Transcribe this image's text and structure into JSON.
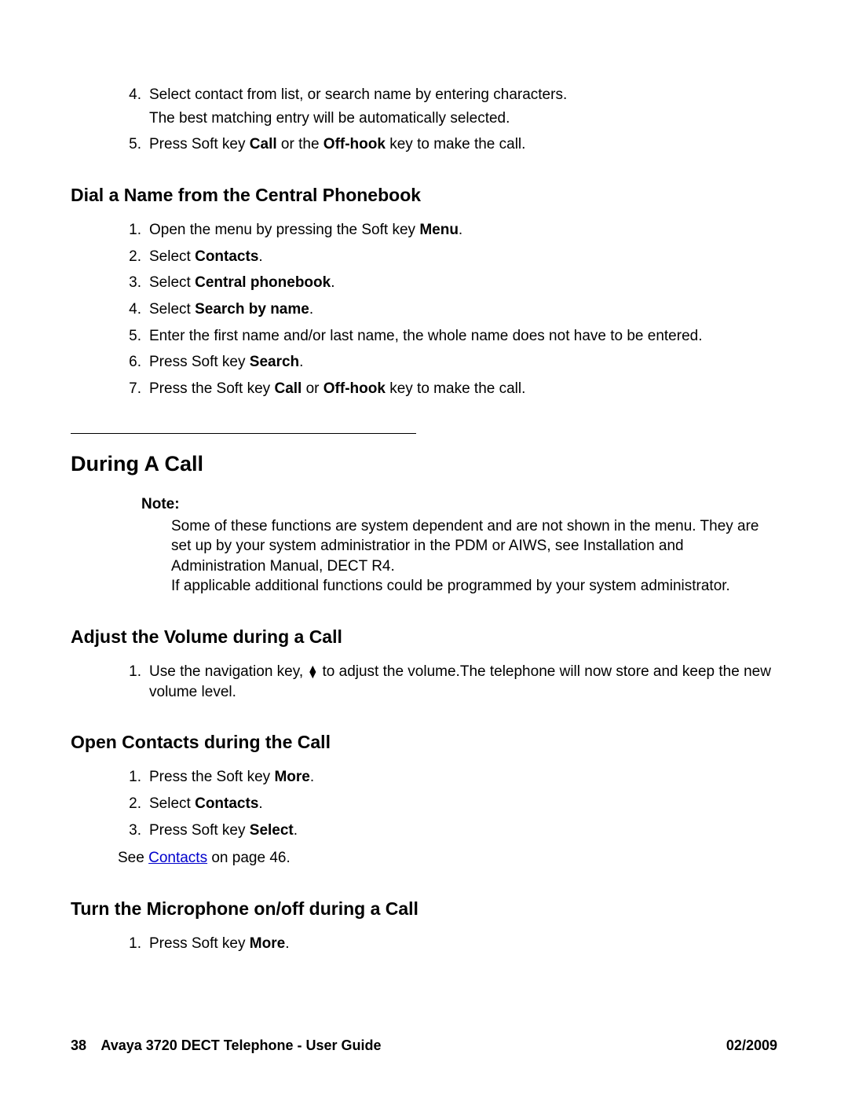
{
  "top_list": [
    {
      "num": "4.",
      "lines": [
        [
          {
            "t": "Select contact from list, or search name by entering characters."
          }
        ],
        [
          {
            "t": "The best matching entry will be automatically selected."
          }
        ]
      ]
    },
    {
      "num": "5.",
      "lines": [
        [
          {
            "t": "Press Soft key "
          },
          {
            "t": "Call",
            "b": true
          },
          {
            "t": " or the "
          },
          {
            "t": "Off-hook",
            "b": true
          },
          {
            "t": " key to make the call."
          }
        ]
      ]
    }
  ],
  "sect_dial": {
    "title": "Dial a Name from the Central Phonebook",
    "items": [
      {
        "num": "1.",
        "lines": [
          [
            {
              "t": "Open the menu by pressing the Soft key "
            },
            {
              "t": "Menu",
              "b": true
            },
            {
              "t": "."
            }
          ]
        ]
      },
      {
        "num": "2.",
        "lines": [
          [
            {
              "t": "Select "
            },
            {
              "t": "Contacts",
              "b": true
            },
            {
              "t": "."
            }
          ]
        ]
      },
      {
        "num": "3.",
        "lines": [
          [
            {
              "t": "Select "
            },
            {
              "t": "Central phonebook",
              "b": true
            },
            {
              "t": "."
            }
          ]
        ]
      },
      {
        "num": "4.",
        "lines": [
          [
            {
              "t": "Select "
            },
            {
              "t": "Search by name",
              "b": true
            },
            {
              "t": "."
            }
          ]
        ]
      },
      {
        "num": "5.",
        "lines": [
          [
            {
              "t": "Enter the first name and/or last name, the whole name does not have to be entered."
            }
          ]
        ]
      },
      {
        "num": "6.",
        "lines": [
          [
            {
              "t": "Press Soft key "
            },
            {
              "t": "Search",
              "b": true
            },
            {
              "t": "."
            }
          ]
        ]
      },
      {
        "num": "7.",
        "lines": [
          [
            {
              "t": "Press the Soft key "
            },
            {
              "t": "Call",
              "b": true
            },
            {
              "t": " or "
            },
            {
              "t": "Off-hook",
              "b": true
            },
            {
              "t": " key to make the call."
            }
          ]
        ]
      }
    ]
  },
  "during_call": {
    "title": "During A Call",
    "note_label": "Note:",
    "note_body": "Some of these functions are system dependent and are not shown in the menu. They are set up by your system administratior in the PDM or AIWS, see Installation and Administration Manual, DECT R4.\nIf applicable additional functions could be programmed by your system administrator."
  },
  "sect_volume": {
    "title": "Adjust the Volume during a Call",
    "items": [
      {
        "num": "1.",
        "lines": [
          [
            {
              "t": "Use the navigation key, "
            },
            {
              "icon": "updown-icon"
            },
            {
              "t": " to adjust the volume.The telephone will now store and keep the new volume level."
            }
          ]
        ]
      }
    ]
  },
  "sect_open": {
    "title": "Open Contacts during the Call",
    "items": [
      {
        "num": "1.",
        "lines": [
          [
            {
              "t": "Press the Soft key "
            },
            {
              "t": "More",
              "b": true
            },
            {
              "t": "."
            }
          ]
        ]
      },
      {
        "num": "2.",
        "lines": [
          [
            {
              "t": "Select "
            },
            {
              "t": "Contacts",
              "b": true
            },
            {
              "t": "."
            }
          ]
        ]
      },
      {
        "num": "3.",
        "lines": [
          [
            {
              "t": "Press Soft key "
            },
            {
              "t": "Select",
              "b": true
            },
            {
              "t": "."
            }
          ]
        ]
      }
    ],
    "see_prefix": "See ",
    "see_link": "Contacts",
    "see_suffix": " on page 46."
  },
  "sect_mic": {
    "title": "Turn the Microphone on/off during a Call",
    "items": [
      {
        "num": "1.",
        "lines": [
          [
            {
              "t": "Press Soft key "
            },
            {
              "t": "More",
              "b": true
            },
            {
              "t": "."
            }
          ]
        ]
      }
    ]
  },
  "footer": {
    "page": "38",
    "title": "Avaya 3720 DECT Telephone - User Guide",
    "date": "02/2009"
  }
}
